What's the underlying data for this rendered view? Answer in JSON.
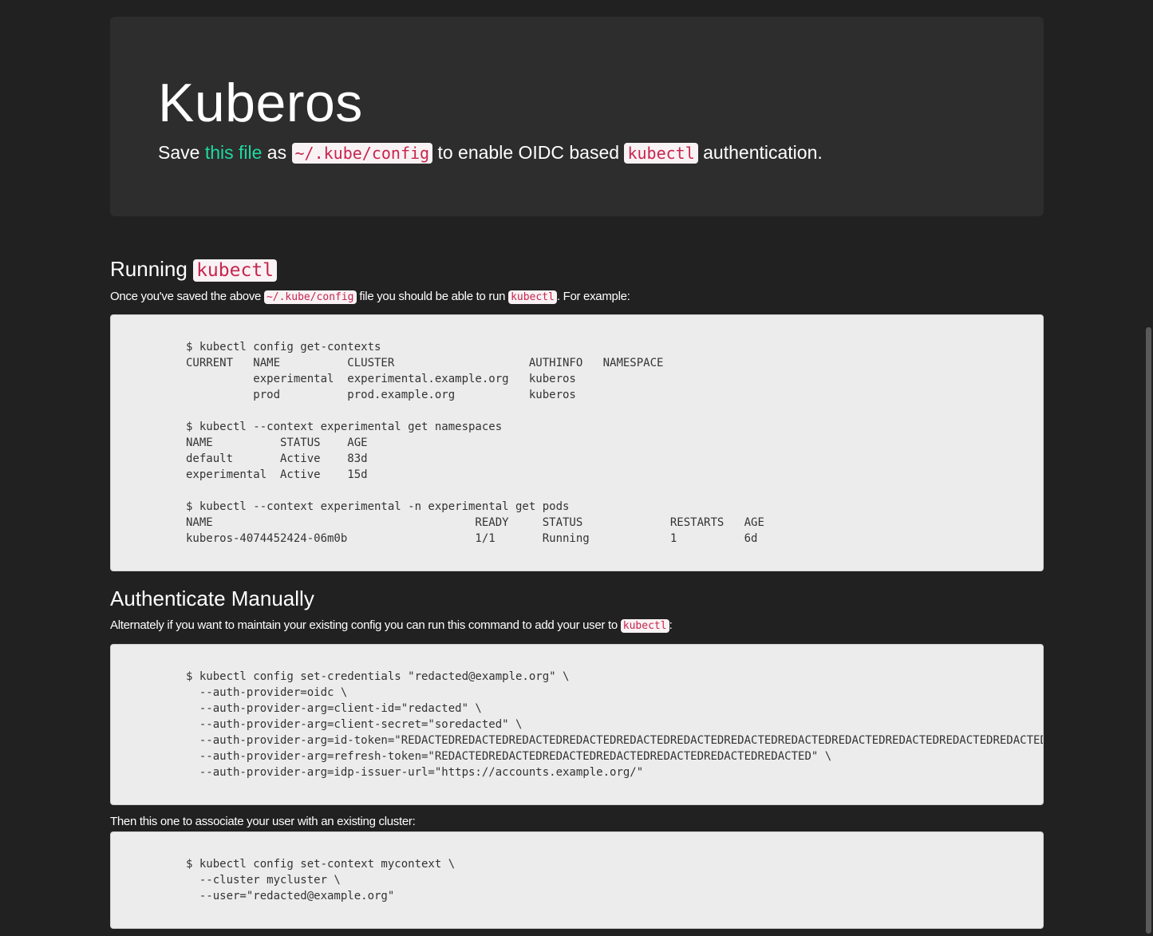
{
  "hero": {
    "title": "Kuberos",
    "lead_prefix": "Save ",
    "lead_link": "this file",
    "lead_as": " as ",
    "lead_path": "~/.kube/config",
    "lead_middle": " to enable OIDC based ",
    "lead_cmd": "kubectl",
    "lead_suffix": " authentication."
  },
  "running": {
    "title_prefix": "Running ",
    "title_code": "kubectl",
    "text_prefix": "Once you've saved the above ",
    "text_path": "~/.kube/config",
    "text_middle": " file you should be able to run ",
    "text_cmd": "kubectl",
    "text_suffix": ". For example:",
    "code": "$ kubectl config get-contexts\nCURRENT   NAME          CLUSTER                    AUTHINFO   NAMESPACE\n          experimental  experimental.example.org   kuberos\n          prod          prod.example.org           kuberos\n\n$ kubectl --context experimental get namespaces\nNAME          STATUS    AGE\ndefault       Active    83d\nexperimental  Active    15d\n\n$ kubectl --context experimental -n experimental get pods\nNAME                                       READY     STATUS             RESTARTS   AGE\nkuberos-4074452424-06m0b                   1/1       Running            1          6d"
  },
  "manual": {
    "title": "Authenticate Manually",
    "text_prefix": "Alternately if you want to maintain your existing config you can run this command to add your user to ",
    "text_cmd": "kubectl",
    "text_suffix": ":",
    "code": "$ kubectl config set-credentials \"redacted@example.org\" \\\n  --auth-provider=oidc \\\n  --auth-provider-arg=client-id=\"redacted\" \\\n  --auth-provider-arg=client-secret=\"soredacted\" \\\n  --auth-provider-arg=id-token=\"REDACTEDREDACTEDREDACTEDREDACTEDREDACTEDREDACTEDREDACTEDREDACTEDREDACTEDREDACTEDREDACTEDREDACTEDREDACTEDREDACTED\" \\\n  --auth-provider-arg=refresh-token=\"REDACTEDREDACTEDREDACTEDREDACTEDREDACTEDREDACTEDREDACTED\" \\\n  --auth-provider-arg=idp-issuer-url=\"https://accounts.example.org/\"",
    "context_text": "Then this one to associate your user with an existing cluster:",
    "context_code": "$ kubectl config set-context mycontext \\\n  --cluster mycluster \\\n  --user=\"redacted@example.org\""
  }
}
